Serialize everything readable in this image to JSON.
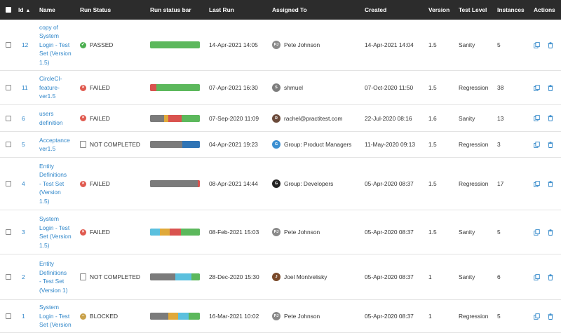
{
  "columns": {
    "id": "Id",
    "sort_indicator": "▲",
    "name": "Name",
    "run_status": "Run Status",
    "run_status_bar": "Run status bar",
    "last_run": "Last Run",
    "assigned_to": "Assigned To",
    "created": "Created",
    "version": "Version",
    "test_level": "Test Level",
    "instances": "Instances",
    "actions": "Actions"
  },
  "status_colors": {
    "passed": "#5cb85c",
    "failed": "#d9534f",
    "blocked": "#e0a93a",
    "not_completed": "#777777",
    "not_run": "#2f74b5",
    "na": "#5bc0de"
  },
  "rows": [
    {
      "id": "12",
      "name_lines": [
        "copy of",
        "System",
        "Login - Test",
        "Set (Version",
        "1.5)"
      ],
      "status": "PASSED",
      "status_icon": "check-circle-icon",
      "status_color": "#4caf50",
      "bar": [
        {
          "pct": 100,
          "color": "#5cb85c"
        }
      ],
      "last_run": "14-Apr-2021 14:05",
      "assigned": "Pete Johnson",
      "avatar_text": "PJ",
      "avatar_color": "#8a8a8a",
      "created": "14-Apr-2021 14:04",
      "version": "1.5",
      "level": "Sanity",
      "instances": "5"
    },
    {
      "id": "11",
      "name_lines": [
        "CircleCI-",
        "feature-",
        "ver1.5"
      ],
      "status": "FAILED",
      "status_icon": "x-circle-icon",
      "status_color": "#e05a4f",
      "bar": [
        {
          "pct": 12,
          "color": "#d9534f"
        },
        {
          "pct": 88,
          "color": "#5cb85c"
        }
      ],
      "last_run": "07-Apr-2021 16:30",
      "assigned": "shmuel",
      "avatar_text": "S",
      "avatar_color": "#7d7d7d",
      "created": "07-Oct-2020 11:50",
      "version": "1.5",
      "level": "Regression",
      "instances": "38"
    },
    {
      "id": "6",
      "name_lines": [
        "users",
        "definition"
      ],
      "status": "FAILED",
      "status_icon": "x-circle-icon",
      "status_color": "#e05a4f",
      "bar": [
        {
          "pct": 28,
          "color": "#7b7b7b"
        },
        {
          "pct": 8,
          "color": "#e0a93a"
        },
        {
          "pct": 27,
          "color": "#d9534f"
        },
        {
          "pct": 37,
          "color": "#5cb85c"
        }
      ],
      "last_run": "07-Sep-2020 11:09",
      "assigned": "rachel@practitest.com",
      "avatar_text": "R",
      "avatar_color": "#6b4a3a",
      "created": "22-Jul-2020 08:16",
      "version": "1.6",
      "level": "Sanity",
      "instances": "13"
    },
    {
      "id": "5",
      "name_lines": [
        "Acceptance",
        "ver1.5"
      ],
      "status": "NOT COMPLETED",
      "status_icon": "document-icon",
      "status_color": "#777777",
      "bar": [
        {
          "pct": 65,
          "color": "#7b7b7b"
        },
        {
          "pct": 35,
          "color": "#2f74b5"
        }
      ],
      "last_run": "04-Apr-2021 19:23",
      "assigned": "Group: Product Managers",
      "avatar_text": "G",
      "avatar_color": "#3b8fd1",
      "created": "11-May-2020 09:13",
      "version": "1.5",
      "level": "Regression",
      "instances": "3"
    },
    {
      "id": "4",
      "name_lines": [
        "Entity",
        "Definitions",
        "- Test Set",
        "(Version",
        "1.5)"
      ],
      "status": "FAILED",
      "status_icon": "x-circle-icon",
      "status_color": "#e05a4f",
      "bar": [
        {
          "pct": 96,
          "color": "#7b7b7b"
        },
        {
          "pct": 4,
          "color": "#d9534f"
        }
      ],
      "last_run": "08-Apr-2021 14:44",
      "assigned": "Group: Developers",
      "avatar_text": "G",
      "avatar_color": "#222222",
      "created": "05-Apr-2020 08:37",
      "version": "1.5",
      "level": "Regression",
      "instances": "17"
    },
    {
      "id": "3",
      "name_lines": [
        "System",
        "Login - Test",
        "Set (Version",
        "1.5)"
      ],
      "status": "FAILED",
      "status_icon": "x-circle-icon",
      "status_color": "#e05a4f",
      "bar": [
        {
          "pct": 20,
          "color": "#5bc0de"
        },
        {
          "pct": 20,
          "color": "#e0a93a"
        },
        {
          "pct": 22,
          "color": "#d9534f"
        },
        {
          "pct": 38,
          "color": "#5cb85c"
        }
      ],
      "last_run": "08-Feb-2021 15:03",
      "assigned": "Pete Johnson",
      "avatar_text": "PJ",
      "avatar_color": "#8a8a8a",
      "created": "05-Apr-2020 08:37",
      "version": "1.5",
      "level": "Sanity",
      "instances": "5"
    },
    {
      "id": "2",
      "name_lines": [
        "Entity",
        "Definitions",
        "- Test Set",
        "(Version 1)"
      ],
      "status": "NOT COMPLETED",
      "status_icon": "document-icon",
      "status_color": "#777777",
      "bar": [
        {
          "pct": 50,
          "color": "#7b7b7b"
        },
        {
          "pct": 33,
          "color": "#5bc0de"
        },
        {
          "pct": 17,
          "color": "#5cb85c"
        }
      ],
      "last_run": "28-Dec-2020 15:30",
      "assigned": "Joel Montvelisky",
      "avatar_text": "J",
      "avatar_color": "#7a4a2a",
      "created": "05-Apr-2020 08:37",
      "version": "1",
      "level": "Sanity",
      "instances": "6"
    },
    {
      "id": "1",
      "name_lines": [
        "System",
        "Login - Test",
        "Set (Version"
      ],
      "status": "BLOCKED",
      "status_icon": "blocked-circle-icon",
      "status_color": "#c9a14a",
      "bar": [
        {
          "pct": 36,
          "color": "#7b7b7b"
        },
        {
          "pct": 20,
          "color": "#e0a93a"
        },
        {
          "pct": 22,
          "color": "#5bc0de"
        },
        {
          "pct": 22,
          "color": "#5cb85c"
        }
      ],
      "last_run": "16-Mar-2021 10:02",
      "assigned": "Pete Johnson",
      "avatar_text": "PJ",
      "avatar_color": "#8a8a8a",
      "created": "05-Apr-2020 08:37",
      "version": "1",
      "level": "Regression",
      "instances": "5"
    }
  ]
}
